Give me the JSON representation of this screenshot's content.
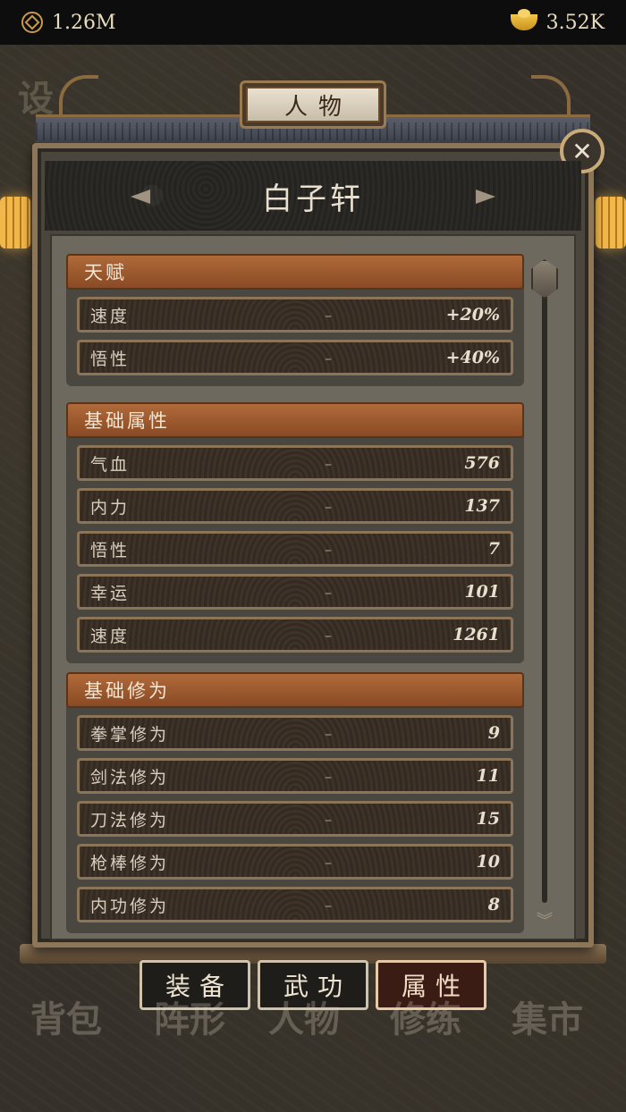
{
  "currency": {
    "coins": "1.26M",
    "ingots": "3.52K"
  },
  "window": {
    "title": "人物"
  },
  "character": {
    "name": "白子轩"
  },
  "sections": [
    {
      "title": "天赋",
      "rows": [
        {
          "label": "速度",
          "dash": "–",
          "value": "+20%"
        },
        {
          "label": "悟性",
          "dash": "–",
          "value": "+40%"
        }
      ]
    },
    {
      "title": "基础属性",
      "rows": [
        {
          "label": "气血",
          "dash": "–",
          "value": "576"
        },
        {
          "label": "内力",
          "dash": "–",
          "value": "137"
        },
        {
          "label": "悟性",
          "dash": "–",
          "value": "7"
        },
        {
          "label": "幸运",
          "dash": "–",
          "value": "101"
        },
        {
          "label": "速度",
          "dash": "–",
          "value": "1261"
        }
      ]
    },
    {
      "title": "基础修为",
      "rows": [
        {
          "label": "拳掌修为",
          "dash": "–",
          "value": "9"
        },
        {
          "label": "剑法修为",
          "dash": "–",
          "value": "11"
        },
        {
          "label": "刀法修为",
          "dash": "–",
          "value": "15"
        },
        {
          "label": "枪棒修为",
          "dash": "–",
          "value": "10"
        },
        {
          "label": "内功修为",
          "dash": "–",
          "value": "8"
        }
      ]
    }
  ],
  "tabs": {
    "equip": "装备",
    "martial": "武功",
    "attributes": "属性"
  },
  "background_text": {
    "map_mark": "设",
    "nav": [
      "背包",
      "阵形",
      "人物",
      "修练",
      "集市"
    ]
  }
}
